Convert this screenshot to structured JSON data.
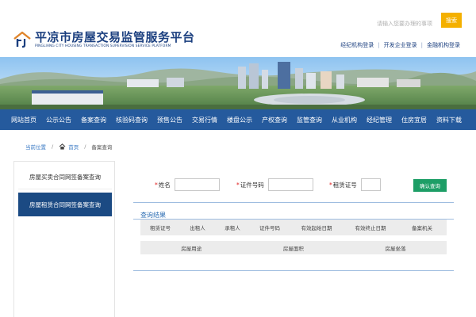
{
  "header": {
    "title_cn": "平凉市房屋交易监管服务平台",
    "title_en": "PINGLIANG CITY HOUSING TRANSACTION SUPERVISION SERVICE PLATFORM",
    "search_placeholder": "请输入您要办理的事项",
    "search_button": "搜索",
    "links": [
      "经纪机构登录",
      "开发企业登录",
      "金融机构登录"
    ],
    "link_separator": "|"
  },
  "nav": {
    "items": [
      "网站首页",
      "公示公告",
      "备案查询",
      "核验码查询",
      "预售公告",
      "交易行情",
      "楼盘公示",
      "产权查询",
      "监管查询",
      "从业机构",
      "经纪管理",
      "住房宜居",
      "资料下载"
    ]
  },
  "breadcrumb": {
    "location_label": "当前位置",
    "separator": "/",
    "home": "首页",
    "current": "备案查询"
  },
  "sidebar": {
    "items": [
      {
        "label": "房屋买卖合同网签备案查询",
        "active": false
      },
      {
        "label": "房屋租赁合同网签备案查询",
        "active": true
      }
    ]
  },
  "form": {
    "required_mark": "*",
    "fields": [
      {
        "label": "姓名",
        "value": ""
      },
      {
        "label": "证件号码",
        "value": ""
      },
      {
        "label": "租赁证号",
        "value": ""
      }
    ],
    "confirm_button": "确认查询"
  },
  "results": {
    "title": "查询结果",
    "columns_row1": [
      "租赁证号",
      "出租人",
      "承租人",
      "证件号码",
      "有效起始日期",
      "有效终止日期",
      "备案机关"
    ],
    "columns_row2": [
      "房屋用途",
      "房屋面积",
      "房屋坐落"
    ]
  },
  "colors": {
    "brand_blue": "#255a9d",
    "dark_blue": "#1b3f7f",
    "search_yellow": "#f4b000",
    "confirm_green": "#1d9e66",
    "active_sidebar": "#1b4a83",
    "result_title_blue": "#2f6fb4"
  },
  "icons": {
    "logo": "house-logo-icon",
    "home": "home-icon"
  }
}
